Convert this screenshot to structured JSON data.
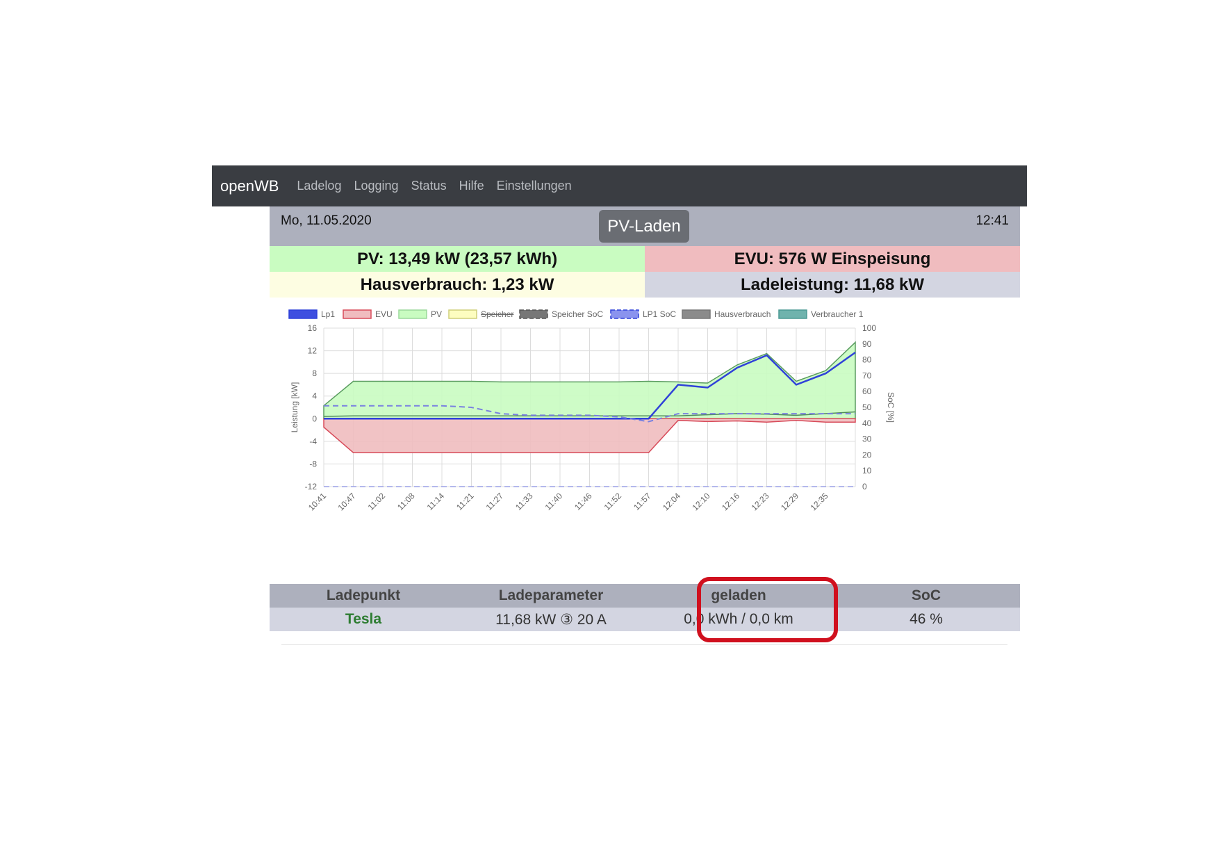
{
  "nav": {
    "brand": "openWB",
    "items": [
      "Ladelog",
      "Logging",
      "Status",
      "Hilfe",
      "Einstellungen"
    ]
  },
  "header": {
    "date": "Mo, 11.05.2020",
    "mode_button": "PV-Laden",
    "time": "12:41"
  },
  "stats": {
    "pv": "PV: 13,49 kW (23,57 kWh)",
    "evu": "EVU: 576 W Einspeisung",
    "hausverbrauch": "Hausverbrauch: 1,23 kW",
    "ladeleistung": "Ladeleistung: 11,68 kW"
  },
  "colors": {
    "nav_bg": "#3a3d42",
    "pv_bg": "#c9fcc1",
    "evu_bg": "#f0bcbf",
    "haus_bg": "#fdfde2",
    "lade_bg": "#d3d5e1",
    "lp1": "#2f41d9",
    "evu_line": "#d84b5a",
    "pv_line": "#5a9c60",
    "highlight": "#d0101e",
    "tesla": "#2e7d32"
  },
  "table": {
    "headers": [
      "Ladepunkt",
      "Ladeparameter",
      "geladen",
      "SoC"
    ],
    "row": {
      "ladepunkt": "Tesla",
      "ladeparameter": "11,68 kW ③ 20 A",
      "geladen": "0,0 kWh / 0,0 km",
      "soc": "46 %"
    }
  },
  "chart_data": {
    "type": "area",
    "legend_position": "top",
    "legend": [
      "Lp1",
      "EVU",
      "PV",
      "Speicher",
      "Speicher SoC",
      "LP1 SoC",
      "Hausverbrauch",
      "Verbraucher 1"
    ],
    "legend_hidden": [
      "Speicher"
    ],
    "xlabel": "",
    "ylabel": "Leistung [kW]",
    "y2label": "SoC [%]",
    "ylim": [
      -12,
      16
    ],
    "yticks": [
      16,
      12,
      8,
      4,
      0,
      -4,
      -8,
      -12
    ],
    "y2lim": [
      0,
      100
    ],
    "y2ticks": [
      100,
      90,
      80,
      70,
      60,
      50,
      40,
      30,
      20,
      10,
      0
    ],
    "grid": true,
    "x": [
      "10:41",
      "10:47",
      "11:02",
      "11:08",
      "11:14",
      "11:21",
      "11:27",
      "11:33",
      "11:40",
      "11:46",
      "11:52",
      "11:57",
      "12:04",
      "12:10",
      "12:16",
      "12:23",
      "12:29",
      "12:35"
    ],
    "series": [
      {
        "name": "PV",
        "values": [
          2.3,
          6.6,
          6.6,
          6.6,
          6.6,
          6.6,
          6.5,
          6.5,
          6.5,
          6.5,
          6.5,
          6.6,
          6.5,
          6.3,
          9.5,
          11.5,
          6.6,
          8.5,
          13.5
        ]
      },
      {
        "name": "Lp1",
        "values": [
          0,
          0,
          0,
          0,
          0,
          0,
          0,
          0,
          0,
          0,
          0,
          0,
          6,
          5.5,
          9,
          11.2,
          6,
          8,
          11.7
        ]
      },
      {
        "name": "EVU",
        "values": [
          -1.5,
          -6,
          -6,
          -6,
          -6,
          -6,
          -6,
          -6,
          -6,
          -6,
          -6,
          -6,
          -0.3,
          -0.5,
          -0.4,
          -0.6,
          -0.3,
          -0.6,
          -0.6
        ]
      },
      {
        "name": "Hausverbrauch",
        "values": [
          0.4,
          0.5,
          0.5,
          0.5,
          0.5,
          0.5,
          0.5,
          0.5,
          0.5,
          0.5,
          0.5,
          0.5,
          0.5,
          0.7,
          0.9,
          0.8,
          0.6,
          0.9,
          1.2
        ]
      },
      {
        "name": "LP1 SoC",
        "values": [
          51,
          51,
          51,
          51,
          51,
          50,
          46,
          45,
          45,
          45,
          44,
          41,
          46,
          46,
          46,
          46,
          46,
          46,
          46
        ]
      },
      {
        "name": "Speicher SoC",
        "values": [
          0,
          0,
          0,
          0,
          0,
          0,
          0,
          0,
          0,
          0,
          0,
          0,
          0,
          0,
          0,
          0,
          0,
          0,
          0
        ]
      }
    ]
  }
}
